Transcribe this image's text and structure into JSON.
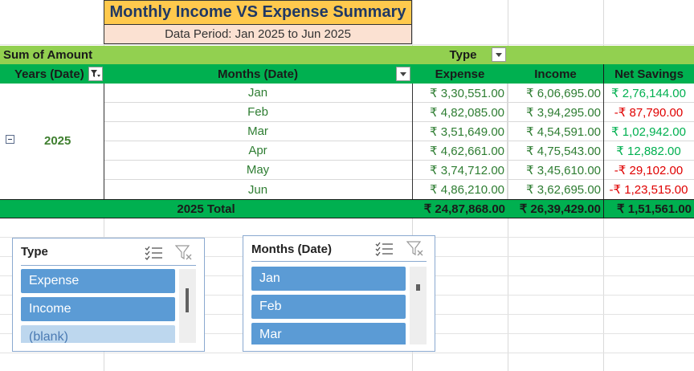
{
  "title": "Monthly Income VS Expense Summary",
  "period": "Data Period: Jan 2025 to Jun 2025",
  "pivot": {
    "corner_label": "Sum of Amount",
    "column_field": "Type",
    "row_header_years": "Years (Date)",
    "row_header_months": "Months (Date)",
    "col_expense": "Expense",
    "col_income": "Income",
    "col_net": "Net Savings",
    "year": "2025",
    "collapse_symbol": "⊟",
    "rows": [
      {
        "month": "Jan",
        "expense": "₹ 3,30,551.00",
        "income": "₹ 6,06,695.00",
        "net": "₹ 2,76,144.00",
        "negative": false
      },
      {
        "month": "Feb",
        "expense": "₹ 4,82,085.00",
        "income": "₹ 3,94,295.00",
        "net": "-₹ 87,790.00",
        "negative": true
      },
      {
        "month": "Mar",
        "expense": "₹ 3,51,649.00",
        "income": "₹ 4,54,591.00",
        "net": "₹ 1,02,942.00",
        "negative": false
      },
      {
        "month": "Apr",
        "expense": "₹ 4,62,661.00",
        "income": "₹ 4,75,543.00",
        "net": "₹ 12,882.00",
        "negative": false
      },
      {
        "month": "May",
        "expense": "₹ 3,74,712.00",
        "income": "₹ 3,45,610.00",
        "net": "-₹ 29,102.00",
        "negative": true
      },
      {
        "month": "Jun",
        "expense": "₹ 4,86,210.00",
        "income": "₹ 3,62,695.00",
        "net": "-₹ 1,23,515.00",
        "negative": true
      }
    ],
    "total_label": "2025 Total",
    "total_expense": "₹ 24,87,868.00",
    "total_income": "₹ 26,39,429.00",
    "total_net": "₹ 1,51,561.00"
  },
  "slicer_type": {
    "title": "Type",
    "items": [
      "Expense",
      "Income",
      "(blank)"
    ]
  },
  "slicer_months": {
    "title": "Months (Date)",
    "items": [
      "Jan",
      "Feb",
      "Mar"
    ]
  },
  "icons": {
    "multiselect": "multi-select-icon",
    "clear_filter": "clear-filter-icon",
    "dropdown": "dropdown-arrow-icon",
    "filter_applied": "filter-applied-icon"
  },
  "colors": {
    "title_fill": "#ffc94d",
    "title_text": "#1f3864",
    "period_fill": "#fbe1d2",
    "light_green": "#92d050",
    "dark_green": "#00b050",
    "positive": "#00b050",
    "negative": "#e00000",
    "slicer_item": "#5b9bd5"
  }
}
